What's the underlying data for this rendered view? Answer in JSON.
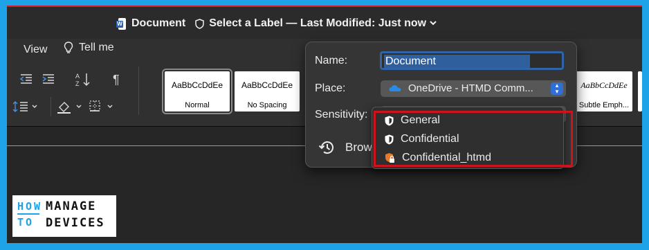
{
  "titlebar": {
    "doc_name": "Document",
    "label_text": "Select a Label — Last Modified: Just now",
    "icons": [
      "word-doc-icon",
      "sensitivity-label-icon",
      "chevron-down-icon"
    ]
  },
  "ribbon": {
    "tabs": [
      {
        "label": "View"
      },
      {
        "label": "Tell me"
      }
    ],
    "styles": [
      {
        "sample": "AaBbCcDdEe",
        "name": "Normal"
      },
      {
        "sample": "AaBbCcDdEe",
        "name": "No Spacing"
      },
      {
        "sample": "AaBbCcDdEe",
        "name": "Subtle Emph..."
      }
    ],
    "icons": [
      "decrease-indent-icon",
      "increase-indent-icon",
      "sort-icon",
      "pilcrow-icon",
      "line-spacing-icon",
      "shading-icon",
      "borders-icon"
    ]
  },
  "dialog": {
    "name_label": "Name:",
    "name_value": "Document",
    "place_label": "Place:",
    "place_value": "OneDrive - HTMD Comm...",
    "sensitivity_label": "Sensitivity:",
    "browse_label": "Brow"
  },
  "sensitivity_menu": {
    "items": [
      {
        "label": "General",
        "icon": "shield-icon"
      },
      {
        "label": "Confidential",
        "icon": "shield-icon"
      },
      {
        "label": "Confidential_htmd",
        "icon": "shield-lock-icon"
      }
    ]
  },
  "logo": {
    "line1a": "HOW",
    "line1b": "MANAGE",
    "line2a": "TO",
    "line2b": "DEVICES"
  },
  "colors": {
    "background_border": "#1ea2e8",
    "accent_blue": "#2f6fd6",
    "highlight_red": "#d0121b",
    "title_red_line": "#d81b2b"
  }
}
